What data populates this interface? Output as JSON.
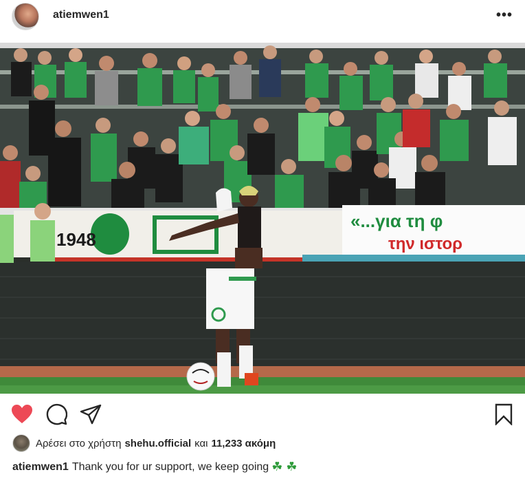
{
  "post": {
    "username": "atiemwen1",
    "more_icon": "more-horizontal-icon",
    "more_glyph": "•••"
  },
  "photo": {
    "banner_line1": "«...για τη φ",
    "banner_line2": "την ιστορ",
    "shirt_number": "1948",
    "colors": {
      "grass": "#3f8a3a",
      "crowd_green": "#2f9a4e",
      "track": "#b5694a"
    }
  },
  "actions": {
    "like_icon": "heart-icon",
    "comment_icon": "comment-icon",
    "share_icon": "share-icon",
    "save_icon": "bookmark-icon",
    "like_color": "#ed4956"
  },
  "likes": {
    "prefix": "Αρέσει στο χρήστη",
    "user": "shehu.official",
    "connector": "και",
    "count": "11,233 ακόμη"
  },
  "caption": {
    "username": "atiemwen1",
    "text": "Thank you for ur support, we keep going",
    "emoji": "☘ ☘"
  }
}
